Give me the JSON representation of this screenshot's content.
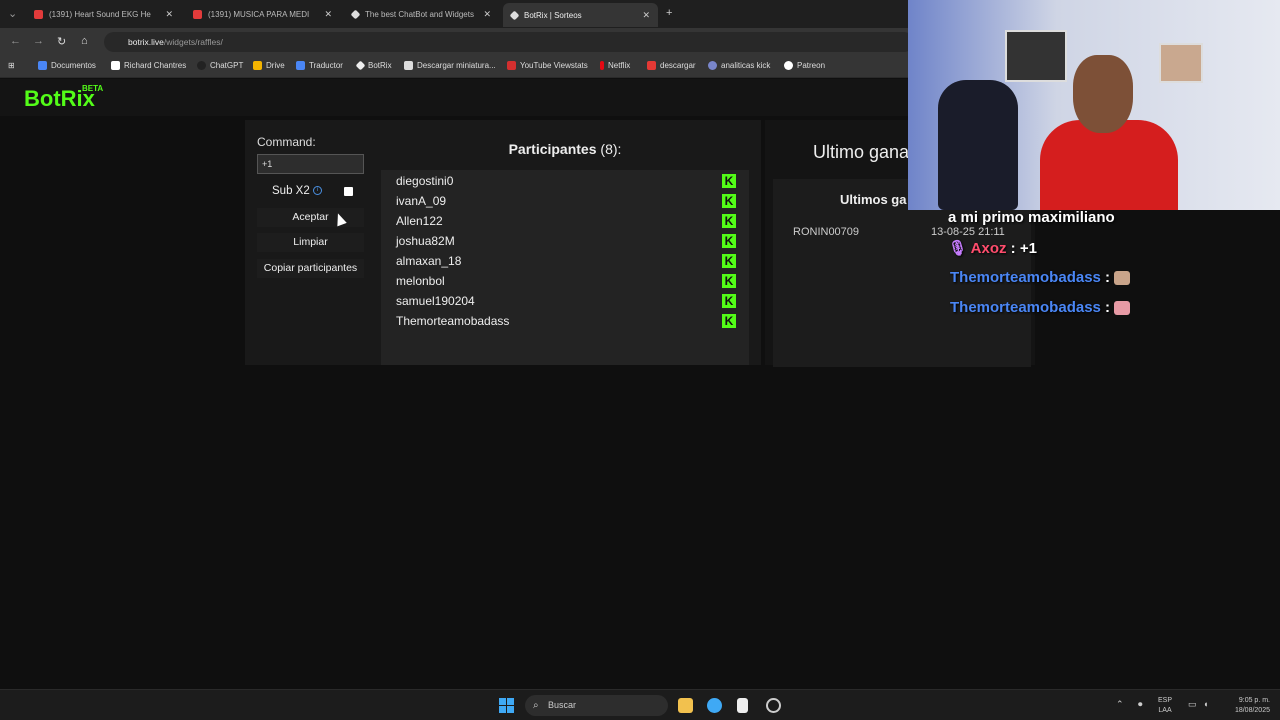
{
  "browser": {
    "tabs": [
      {
        "label": "(1391) Heart Sound EKG He",
        "active": false
      },
      {
        "label": "(1391) MUSICA PARA MEDI",
        "active": false
      },
      {
        "label": "The best ChatBot and Widgets",
        "active": false
      },
      {
        "label": "BotRix | Sorteos",
        "active": true
      }
    ],
    "url_host": "botrix.live",
    "url_path": "/widgets/raffles/",
    "bookmarks": [
      "Documentos",
      "Richard Chantres",
      "ChatGPT",
      "Drive",
      "Traductor",
      "BotRix",
      "Descargar miniatura...",
      "YouTube Viewstats",
      "Netflix",
      "descargar",
      "analiticas kick",
      "Patreon"
    ]
  },
  "app": {
    "logo": "BotRix",
    "badge": "BETA"
  },
  "raffle": {
    "command_label": "Command:",
    "command_value": "+1",
    "sub_label": "Sub X2",
    "accept_label": "Aceptar",
    "clear_label": "Limpiar",
    "copy_label": "Copiar participantes"
  },
  "participants": {
    "title": "Participantes",
    "count": "(8):",
    "list": [
      "diegostini0",
      "ivanA_09",
      "Allen122",
      "joshua82M",
      "almaxan_18",
      "melonbol",
      "samuel190204",
      "Themorteamobadass"
    ]
  },
  "winners": {
    "last_winner_title": "Ultimo gana",
    "recent_title": "Ultimos ga",
    "entries": [
      {
        "name": "RONIN00709",
        "date": "13-08-25 21:11"
      }
    ]
  },
  "stream_chat": {
    "lines": [
      {
        "user": "",
        "msg": "a mi primo maximiliano"
      },
      {
        "user": "Axoz",
        "msg": " : +1"
      },
      {
        "user": "Themorteamobadass",
        "msg": " : "
      },
      {
        "user": "Themorteamobadass",
        "msg": " : "
      }
    ]
  },
  "taskbar": {
    "search_placeholder": "Buscar",
    "lang": "ESP",
    "lang2": "LAA",
    "time": "9:05 p. m.",
    "date": "18/08/2025"
  }
}
